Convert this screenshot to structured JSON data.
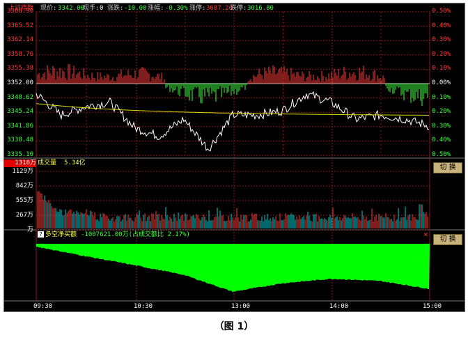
{
  "header": {
    "index_name": "上证指数",
    "price_label": "现价:",
    "price_value": "3342.00",
    "hand_label": "现手:",
    "hand_value": "0",
    "change_label": "涨跌:",
    "change_value": "-10.00",
    "pct_label": "涨幅:",
    "pct_value": "-0.30%",
    "limit_up_label": "涨停:",
    "limit_up_value": "3687.20",
    "limit_down_label": "跌停:",
    "limit_down_value": "3016.80"
  },
  "price_axis": {
    "left_ticks": [
      "3368.90",
      "3365.52",
      "3362.14",
      "3358.76",
      "3355.38",
      "3352.00",
      "3348.62",
      "3345.24",
      "3341.86",
      "3338.48",
      "3335.10"
    ],
    "right_ticks": [
      "0.50%",
      "0.40%",
      "0.30%",
      "0.20%",
      "0.10%",
      "0.00%",
      "0.10%",
      "0.20%",
      "0.30%",
      "0.40%",
      "0.50%"
    ]
  },
  "volume_panel": {
    "title": "成交量",
    "value": "5.34亿",
    "highlight_tick": "1318万",
    "ticks": [
      "1129万",
      "842万",
      "555万",
      "267万",
      "万"
    ],
    "switch_label": "切 换"
  },
  "netbuy_panel": {
    "icon": "indicator-icon",
    "title": "多空净买额",
    "value": "-1007621.00万(占成交额比 2.17%)",
    "close_glyph": "×",
    "switch_label": "切 换"
  },
  "time_axis": [
    "09:30",
    "10:30",
    "13:00",
    "14:00",
    "15:00"
  ],
  "caption": "（图 1）",
  "colors": {
    "up": "#ff3b3b",
    "down": "#3dff3d",
    "price_line": "#ffffff",
    "avg_line": "#e0e000",
    "fill": "#00ff00",
    "grid": "#8b1a1a",
    "bg": "#000000"
  },
  "chart_data": [
    {
      "type": "line",
      "title": "上证指数",
      "x": [
        "09:30",
        "10:30",
        "13:00",
        "14:00",
        "15:00"
      ],
      "ylim": [
        3335.1,
        3368.9
      ],
      "series": [
        {
          "name": "",
          "x": [
            "09:30",
            "09:45",
            "10:00",
            "10:15",
            "10:30",
            "10:45",
            "11:00",
            "11:15",
            "11:30",
            "13:15",
            "13:30",
            "13:45",
            "14:00",
            "14:15",
            "14:30",
            "14:45",
            "15:00"
          ],
          "values": [
            3349.6,
            3344.6,
            3346.6,
            3347.6,
            3341.6,
            3339.6,
            3343.6,
            3336.6,
            3344.6,
            3344.6,
            3345.6,
            3349.6,
            3347.6,
            3343.6,
            3344.6,
            3343.6,
            3342.0
          ]
        }
      ]
    },
    {
      "type": "bar",
      "title": "成交量",
      "ylim": [
        0,
        1318
      ],
      "values_summary": "成交量 5.34亿"
    },
    {
      "type": "area",
      "title": "多空净买额",
      "x": [
        "09:30",
        "10:00",
        "10:30",
        "11:00",
        "11:30",
        "13:30",
        "14:00",
        "14:30",
        "15:00"
      ],
      "values": [
        -0.05,
        -0.22,
        -0.38,
        -0.55,
        -0.85,
        -0.7,
        -0.62,
        -0.66,
        -0.8
      ]
    }
  ]
}
